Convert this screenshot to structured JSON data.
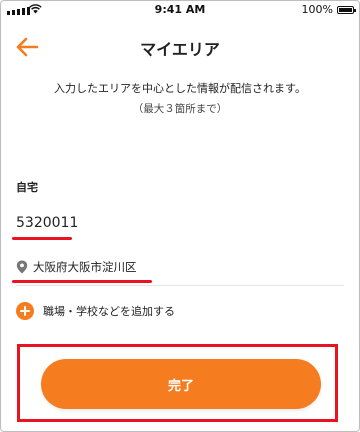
{
  "status_bar": {
    "time": "9:41 AM",
    "battery_text": "100%",
    "battery_level": 1.0
  },
  "header": {
    "title": "マイエリア",
    "back_icon": "arrow-left-icon"
  },
  "intro": {
    "description": "入力したエリアを中心とした情報が配信されます。",
    "sub_description": "（最大３箇所まで）"
  },
  "home": {
    "label": "自宅",
    "postal_code": "5320011",
    "address": "大阪府大阪市淀川区",
    "pin_icon": "map-pin-icon"
  },
  "add_location": {
    "label": "職場・学校などを追加する",
    "icon": "plus-circle-icon"
  },
  "done_button": {
    "label": "完了"
  },
  "colors": {
    "accent": "#f57c1f",
    "highlight": "#e8141f"
  }
}
